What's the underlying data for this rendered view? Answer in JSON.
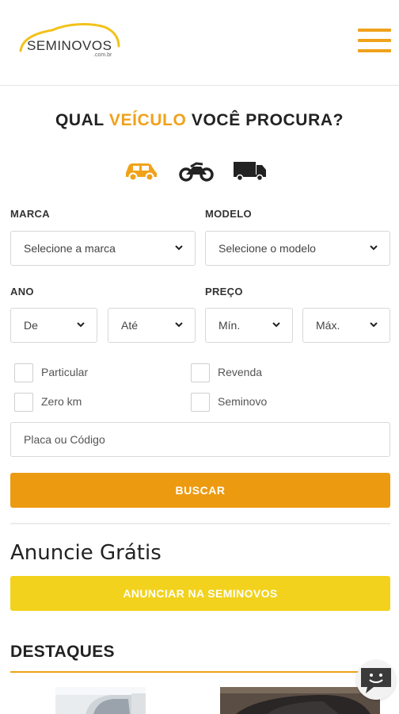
{
  "header": {
    "logo_text": "SEMINOVOS",
    "logo_sub": ".com.br"
  },
  "search": {
    "title_prefix": "QUAL ",
    "title_accent": "VEÍCULO",
    "title_suffix": " VOCÊ PROCURA?",
    "vehicle_types": [
      "car-icon",
      "motorcycle-icon",
      "truck-icon"
    ],
    "brand_label": "MARCA",
    "brand_value": "Selecione a marca",
    "model_label": "MODELO",
    "model_value": "Selecione o modelo",
    "year_label": "ANO",
    "year_from": "De",
    "year_to": "Até",
    "price_label": "PREÇO",
    "price_min": "Mín.",
    "price_max": "Máx.",
    "checkboxes": [
      "Particular",
      "Revenda",
      "Zero km",
      "Seminovo"
    ],
    "plate_placeholder": "Placa ou Código",
    "search_button": "BUSCAR"
  },
  "announce": {
    "title": "Anuncie Grátis",
    "button": "ANUNCIAR NA SEMINOVOS"
  },
  "highlights": {
    "title": "DESTAQUES"
  },
  "colors": {
    "accent": "#f0a21b",
    "search_button": "#ec9a10",
    "announce_button": "#f2d21c"
  }
}
